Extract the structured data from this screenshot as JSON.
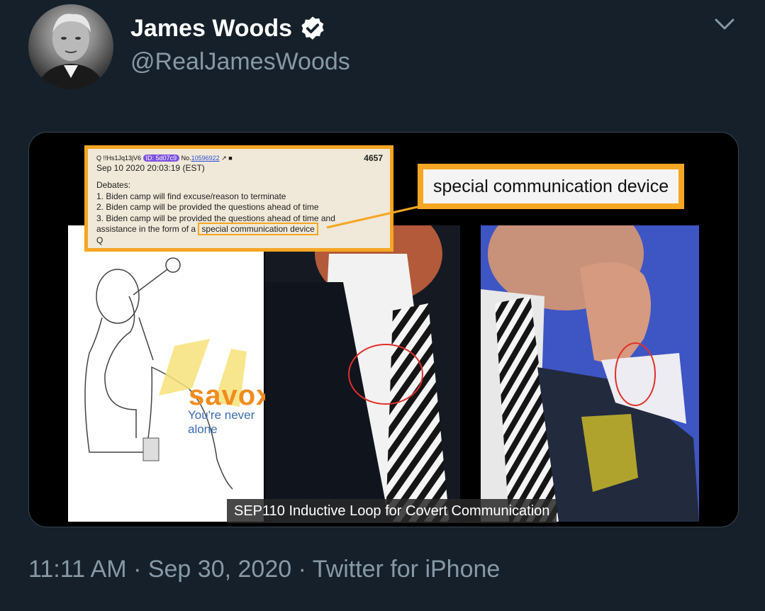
{
  "author": {
    "name": "James Woods",
    "handle": "@RealJamesWoods"
  },
  "icons": {
    "verified": "verified-badge-icon",
    "menu": "chevron-down-icon"
  },
  "colors": {
    "background": "#15202b",
    "secondary_text": "#8899a6",
    "accent_orange": "#f5a623"
  },
  "media": {
    "post": {
      "meta_user": "Q !!Hs1Jq13jV6",
      "meta_id": "ID: 5d07c9",
      "meta_no_label": "No.",
      "meta_no": "10596922",
      "number": "4657",
      "date": "Sep 10 2020 20:03:19 (EST)",
      "lines": [
        "Debates:",
        "1. Biden camp will find excuse/reason to terminate",
        "2. Biden camp will be provided the questions ahead of time",
        "3. Biden camp will be provided the questions ahead of time and"
      ],
      "last_line_prefix": "assistance in the form of a",
      "last_line_highlight": "special communication device",
      "signature": "Q"
    },
    "callout": "special communication device",
    "brand": "savox",
    "brand_tagline": "You're never alone",
    "caption": "SEP110 Inductive Loop for Covert Communication"
  },
  "footer": {
    "time": "11:11 AM",
    "date": "Sep 30, 2020",
    "source": "Twitter for iPhone"
  }
}
